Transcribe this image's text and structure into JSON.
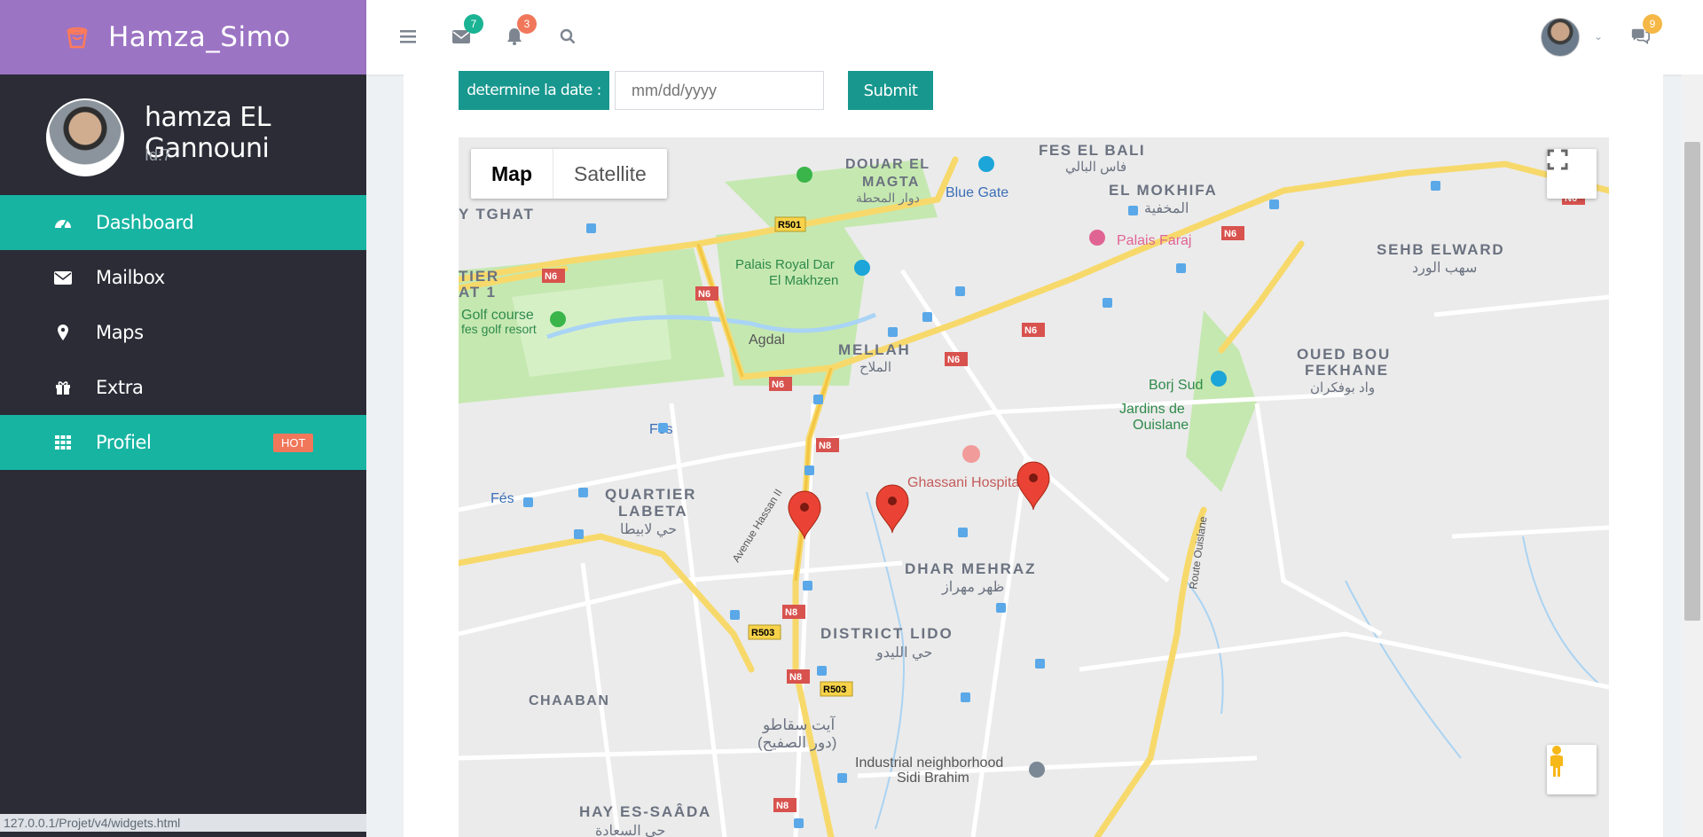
{
  "app": {
    "brand": "Hamza_Simo",
    "brand_icon": "bucket-icon"
  },
  "header": {
    "menu_icon": "hamburger-icon",
    "mail_count": "7",
    "notif_count": "3",
    "chat_count": "9",
    "search_icon": "search-icon"
  },
  "user": {
    "name": "hamza EL Gannouni",
    "id_text": "Id:7"
  },
  "sidebar": {
    "items": [
      {
        "label": "Dashboard",
        "icon": "dashboard-icon",
        "active": true
      },
      {
        "label": "Mailbox",
        "icon": "envelope-icon",
        "active": false
      },
      {
        "label": "Maps",
        "icon": "map-pin-icon",
        "active": false
      },
      {
        "label": "Extra",
        "icon": "gift-icon",
        "active": false
      },
      {
        "label": "Profiel",
        "icon": "grid-icon",
        "active": true,
        "badge": "HOT"
      }
    ]
  },
  "form": {
    "date_label": "determine la date :",
    "date_placeholder": "mm/dd/yyyy",
    "submit_label": "Submit"
  },
  "map": {
    "type_map": "Map",
    "type_satellite": "Satellite",
    "places": {
      "fes_el_bali": "FES EL BALI",
      "fes_el_bali_ar": "فاس البالي",
      "douar": "DOUAR EL",
      "magta": "MAGTA",
      "magta_ar": "دوار المحطة",
      "blue_gate": "Blue Gate",
      "el_mokhifa": "EL MOKHIFA",
      "el_mokhifa_ar": "المخفية",
      "palais_faraj": "Palais Faraj",
      "sehb_elward": "SEHB ELWARD",
      "sehb_elward_ar": "سهب الورد",
      "tghat": "Y TGHAT",
      "tier": "TIER",
      "at1": "AT 1",
      "palais_royal": "Palais Royal Dar",
      "el_makhzen": "El Makhzen",
      "golf": "Golf course",
      "golf_resort": "fes golf resort",
      "agdal": "Agdal",
      "mellah": "MELLAH",
      "mellah_ar": "الملاح",
      "oued": "OUED BOU",
      "fekhane": "FEKHANE",
      "oued_ar": "واد بوفكران",
      "borj_sud": "Borj Sud",
      "jardins": "Jardins de",
      "ouislane": "Ouislane",
      "fes_station": "Fes",
      "fes2": "Fés",
      "quartier": "QUARTIER",
      "labeta": "LABETA",
      "labeta_ar": "حي لابيطا",
      "ghassani": "Ghassani Hospital",
      "hassan": "Avenue Hassan II",
      "dhar": "DHAR MEHRAZ",
      "dhar_ar": "ظهر مهراز",
      "route": "Route Ouislane",
      "lido": "DISTRICT LIDO",
      "lido_ar": "حي الليدو",
      "chaaban": "CHAABAN",
      "ait1": "آيت سقاطو",
      "ait2": "(دور الصفيح)",
      "industrial": "Industrial neighborhood",
      "sidi": "Sidi Brahim",
      "hay": "HAY ES-SAÂDA",
      "hay_ar": "حي السعادة"
    },
    "roads": {
      "r501": "R501",
      "n6": "N6",
      "n8": "N8",
      "r503": "R503"
    }
  },
  "status_url": "127.0.0.1/Projet/v4/widgets.html",
  "colors": {
    "brand": "#9c74c4",
    "sidebar": "#2b2c36",
    "accent": "#17b4a2",
    "button": "#17978e"
  }
}
